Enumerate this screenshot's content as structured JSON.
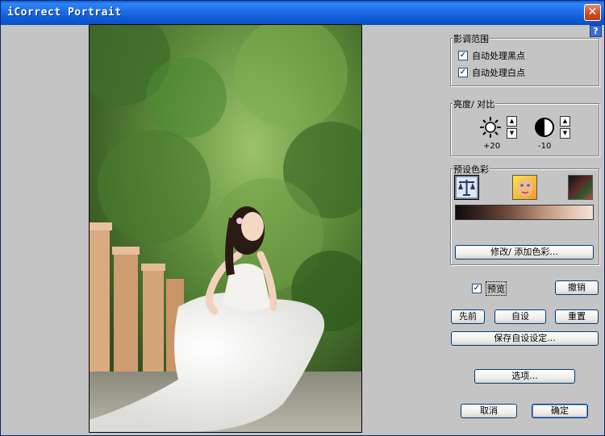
{
  "window": {
    "title": "iCorrect Portrait",
    "close_glyph": "✕",
    "help_glyph": "?"
  },
  "tone_range": {
    "title": "影调范围",
    "black_point": {
      "label": "自动处理黑点",
      "checked": true
    },
    "white_point": {
      "label": "自动处理白点",
      "checked": true
    }
  },
  "brightness_contrast": {
    "title": "亮度∕ 对比",
    "brightness_value": "+20",
    "contrast_value": "-10",
    "up_glyph": "▲",
    "down_glyph": "▼"
  },
  "preset_colors": {
    "title": "预设色彩",
    "edit_button": "修改∕ 添加色彩..."
  },
  "preview": {
    "label": "预览",
    "checked": true
  },
  "buttons": {
    "undo": "撤销",
    "before": "先前",
    "custom": "自设",
    "reset": "重置",
    "save_custom": "保存自设设定...",
    "options": "选项...",
    "cancel": "取消",
    "ok": "确定"
  },
  "colors": {
    "titlebar": "#0b58d0",
    "dialog_bg": "#c4c4c4"
  },
  "icons": {
    "sun": "brightness-sun-icon",
    "contrast": "contrast-half-circle-icon",
    "balance": "scales-icon",
    "face": "skin-face-icon",
    "color": "color-swatch-icon"
  }
}
